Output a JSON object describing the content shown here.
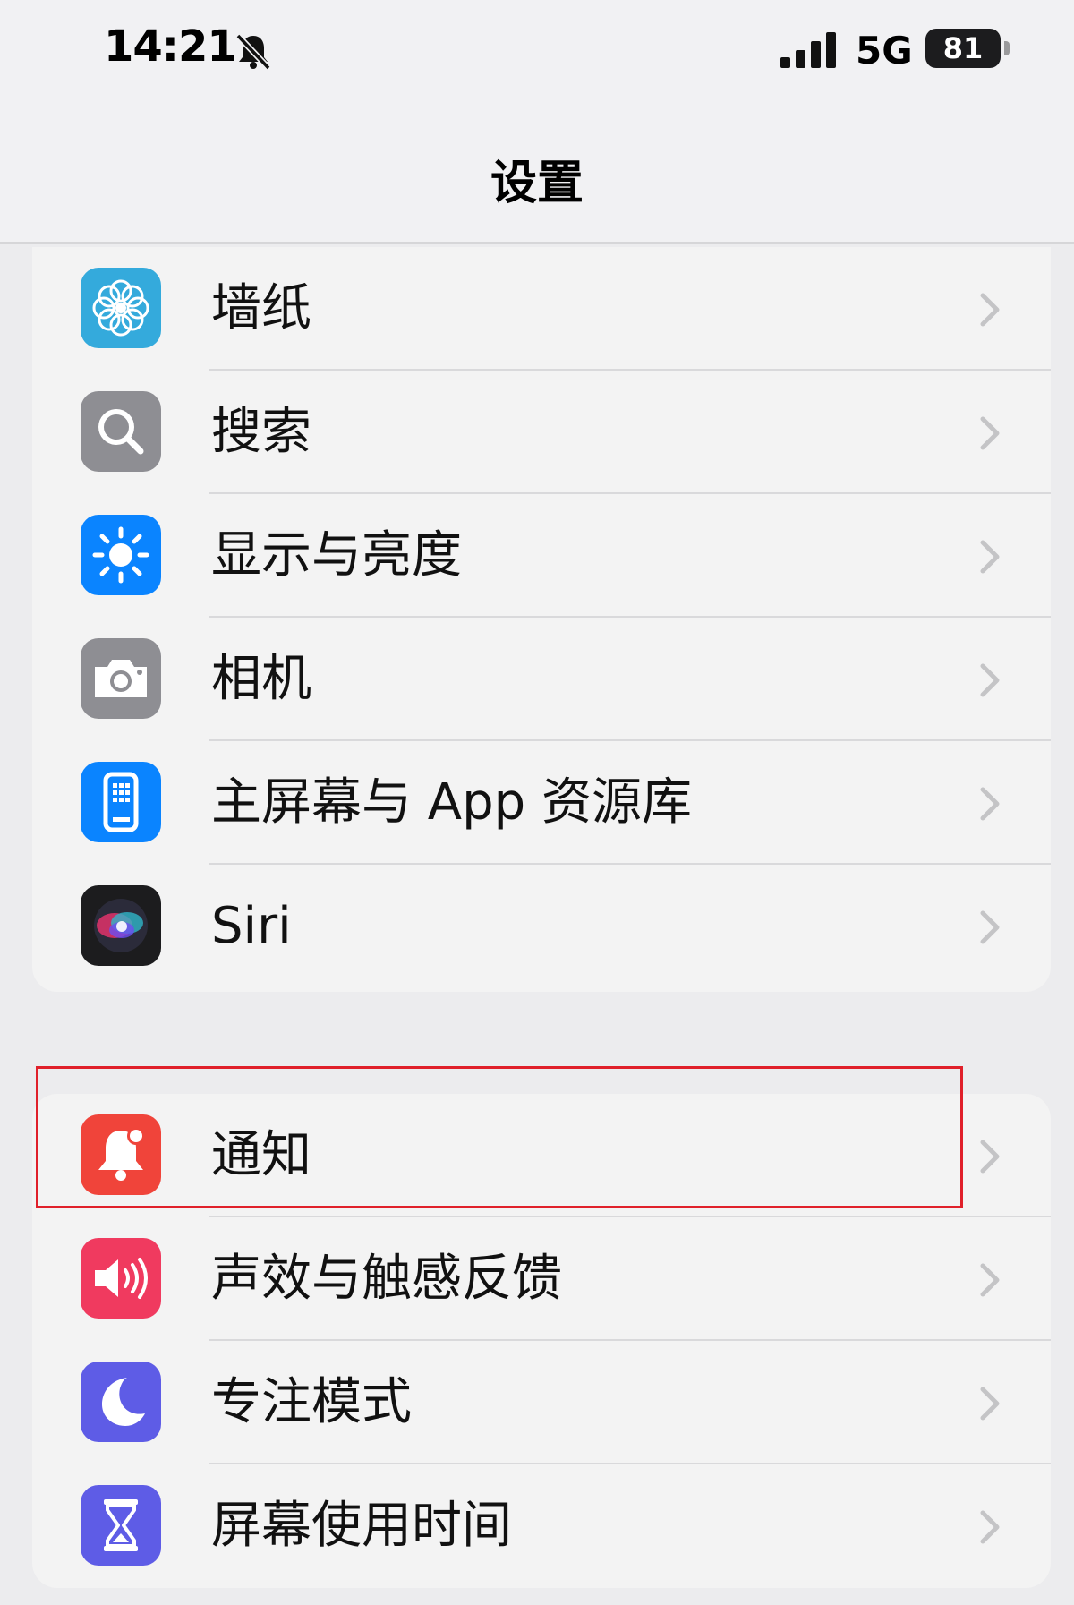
{
  "status": {
    "time": "14:21",
    "network": "5G",
    "battery": "81"
  },
  "nav": {
    "title": "设置"
  },
  "group1": [
    {
      "label": "墙纸",
      "icon": "flower-icon",
      "color": "#34aadc"
    },
    {
      "label": "搜索",
      "icon": "magnifier-icon",
      "color": "#8e8e93"
    },
    {
      "label": "显示与亮度",
      "icon": "sun-icon",
      "color": "#0a84ff"
    },
    {
      "label": "相机",
      "icon": "camera-icon",
      "color": "#8e8e93"
    },
    {
      "label": "主屏幕与 App 资源库",
      "icon": "home-screen-icon",
      "color": "#0a84ff"
    },
    {
      "label": "Siri",
      "icon": "siri-icon",
      "color": "#1c1c1e"
    }
  ],
  "group2": [
    {
      "label": "通知",
      "icon": "notification-bell-icon",
      "color": "#f0443a"
    },
    {
      "label": "声效与触感反馈",
      "icon": "speaker-icon",
      "color": "#f03a5f"
    },
    {
      "label": "专注模式",
      "icon": "moon-icon",
      "color": "#5e5ce6"
    },
    {
      "label": "屏幕使用时间",
      "icon": "hourglass-icon",
      "color": "#5e5ce6"
    }
  ],
  "highlight_color": "#e0202a"
}
